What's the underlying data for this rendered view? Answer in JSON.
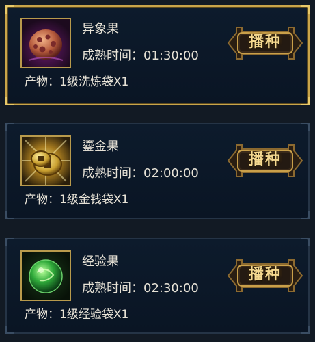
{
  "seeds": [
    {
      "name": "异象果",
      "time_label": "成熟时间：01:30:00",
      "product_label": "产物：1级洗炼袋X1",
      "icon": "egg-icon",
      "selected": true,
      "button_label": "播种"
    },
    {
      "name": "鎏金果",
      "time_label": "成熟时间：02:00:00",
      "product_label": "产物：1级金钱袋X1",
      "icon": "coin-icon",
      "selected": false,
      "button_label": "播种"
    },
    {
      "name": "经验果",
      "time_label": "成熟时间：02:30:00",
      "product_label": "产物：1级经验袋X1",
      "icon": "green-orb-icon",
      "selected": false,
      "button_label": "播种"
    }
  ],
  "colors": {
    "gold_border": "#c9a54a",
    "text": "#e7e2d6",
    "button_text": "#f5d990"
  }
}
